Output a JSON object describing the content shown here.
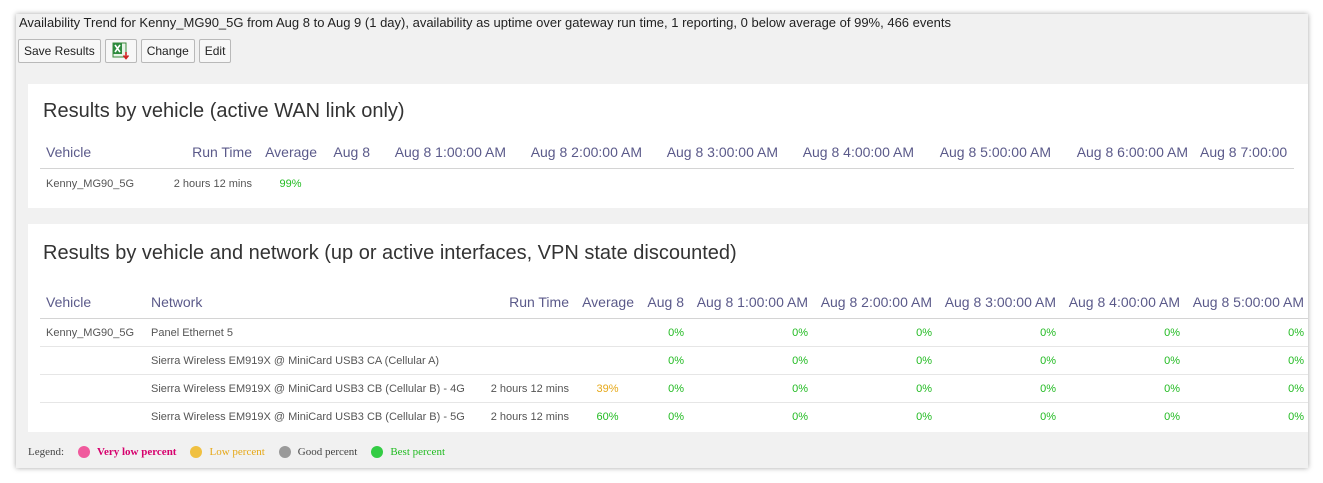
{
  "summary": "Availability Trend for Kenny_MG90_5G from Aug 8 to Aug 9 (1 day), availability as uptime over gateway run time, 1 reporting, 0 below average of 99%, 466 events",
  "toolbar": {
    "save_label": "Save Results",
    "excel_icon": "excel-export-icon",
    "change_label": "Change",
    "edit_label": "Edit"
  },
  "colors": {
    "very_low": "#f05a9d",
    "low": "#f0c040",
    "good": "#9a9a9a",
    "best": "#33cc44",
    "best_text": "#22bb22",
    "low_text": "#e6a817",
    "very_low_text": "#d6006d"
  },
  "panel1": {
    "title": "Results by vehicle (active WAN link only)",
    "headers": [
      "Vehicle",
      "Run Time",
      "Average",
      "Aug 8",
      "Aug 8 1:00:00 AM",
      "Aug 8 2:00:00 AM",
      "Aug 8 3:00:00 AM",
      "Aug 8 4:00:00 AM",
      "Aug 8 5:00:00 AM",
      "Aug 8 6:00:00 AM",
      "Aug 8 7:00:00"
    ],
    "rows": [
      {
        "vehicle": "Kenny_MG90_5G",
        "runtime": "2 hours 12 mins",
        "average": "99%"
      }
    ]
  },
  "panel2": {
    "title": "Results by vehicle and network (up or active interfaces, VPN state discounted)",
    "headers": [
      "Vehicle",
      "Network",
      "Run Time",
      "Average",
      "Aug 8",
      "Aug 8 1:00:00 AM",
      "Aug 8 2:00:00 AM",
      "Aug 8 3:00:00 AM",
      "Aug 8 4:00:00 AM",
      "Aug 8 5:00:00 AM"
    ],
    "rows": [
      {
        "vehicle": "Kenny_MG90_5G",
        "network": "Panel Ethernet 5",
        "runtime": "",
        "average": "",
        "values": [
          "0%",
          "0%",
          "0%",
          "0%",
          "0%",
          "0%"
        ]
      },
      {
        "vehicle": "",
        "network": "Sierra Wireless EM919X @ MiniCard USB3 CA (Cellular A)",
        "runtime": "",
        "average": "",
        "values": [
          "0%",
          "0%",
          "0%",
          "0%",
          "0%",
          "0%"
        ]
      },
      {
        "vehicle": "",
        "network": "Sierra Wireless EM919X @ MiniCard USB3 CB (Cellular B) - 4G",
        "runtime": "2 hours 12 mins",
        "average": "39%",
        "values": [
          "0%",
          "0%",
          "0%",
          "0%",
          "0%",
          "0%"
        ]
      },
      {
        "vehicle": "",
        "network": "Sierra Wireless EM919X @ MiniCard USB3 CB (Cellular B) - 5G",
        "runtime": "2 hours 12 mins",
        "average": "60%",
        "values": [
          "0%",
          "0%",
          "0%",
          "0%",
          "0%",
          "0%"
        ]
      }
    ]
  },
  "legend": {
    "title": "Legend:",
    "items": [
      {
        "label": "Very low percent"
      },
      {
        "label": "Low percent"
      },
      {
        "label": "Good percent"
      },
      {
        "label": "Best percent"
      }
    ]
  }
}
